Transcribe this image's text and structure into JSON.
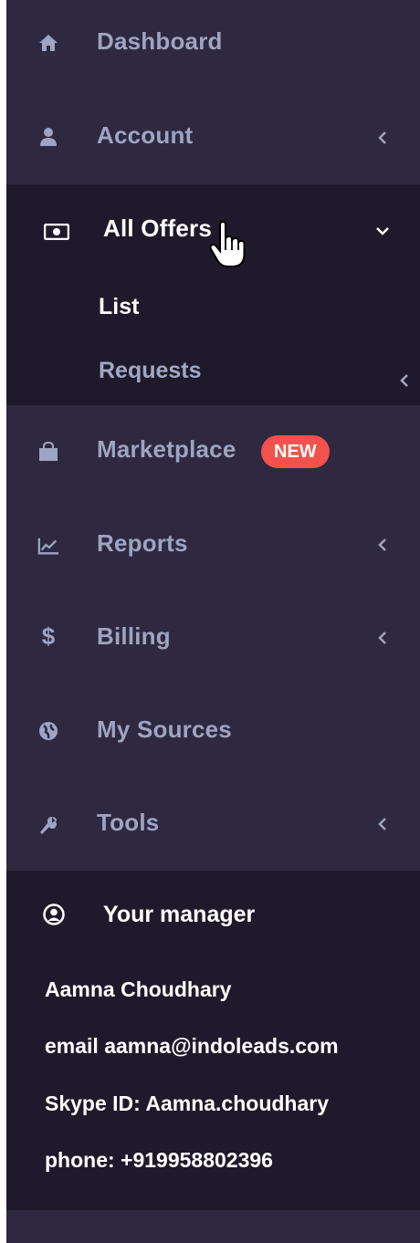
{
  "menu": {
    "dashboard": {
      "label": "Dashboard",
      "icon": "home-icon"
    },
    "account": {
      "label": "Account",
      "icon": "user-icon"
    },
    "all_offers": {
      "label": "All Offers",
      "icon": "money-icon",
      "submenu": [
        {
          "label": "List"
        },
        {
          "label": "Requests"
        }
      ]
    },
    "marketplace": {
      "label": "Marketplace",
      "icon": "shopping-bag-icon",
      "badge": "NEW"
    },
    "reports": {
      "label": "Reports",
      "icon": "line-chart-icon"
    },
    "billing": {
      "label": "Billing",
      "icon": "dollar-icon"
    },
    "my_sources": {
      "label": "My Sources",
      "icon": "globe-icon"
    },
    "tools": {
      "label": "Tools",
      "icon": "wrench-icon"
    }
  },
  "manager": {
    "title": "Your manager",
    "name": "Aamna Choudhary",
    "email": "email aamna@indoleads.com",
    "skype": "Skype ID: Aamna.choudhary",
    "phone": "phone: +919958802396"
  },
  "colors": {
    "sidebar_bg": "#2f2841",
    "active_bg": "#1f1a2b",
    "text_muted": "#9ea4c2",
    "badge_bg": "#f2524b"
  }
}
